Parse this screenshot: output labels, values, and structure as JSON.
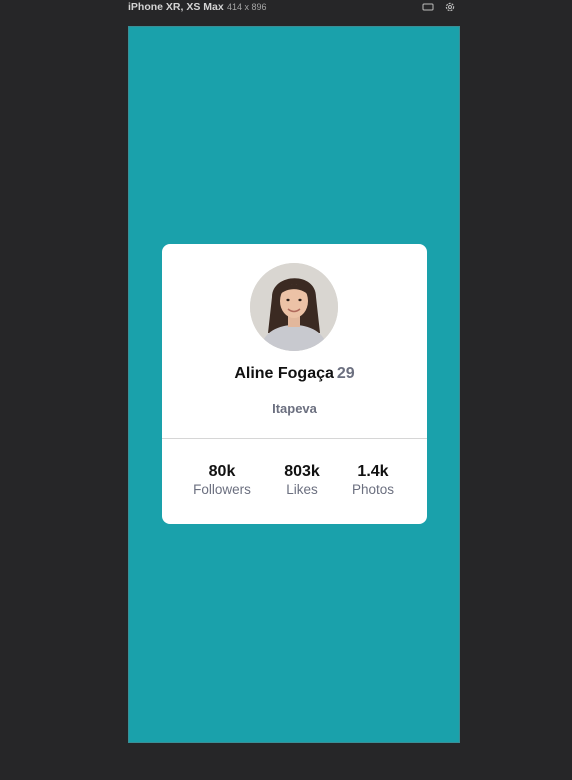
{
  "devtools": {
    "device_name": "iPhone XR, XS Max",
    "device_dims": "414 x 896",
    "icons": [
      "rotate-icon",
      "settings-icon"
    ]
  },
  "colors": {
    "page_background": "#1aa1ab",
    "card_background": "#ffffff",
    "muted_text": "#6b6f7f"
  },
  "profile": {
    "name": "Aline Fogaça",
    "age": "29",
    "location": "Itapeva",
    "stats": [
      {
        "value": "80k",
        "label": "Followers"
      },
      {
        "value": "803k",
        "label": "Likes"
      },
      {
        "value": "1.4k",
        "label": "Photos"
      }
    ]
  }
}
